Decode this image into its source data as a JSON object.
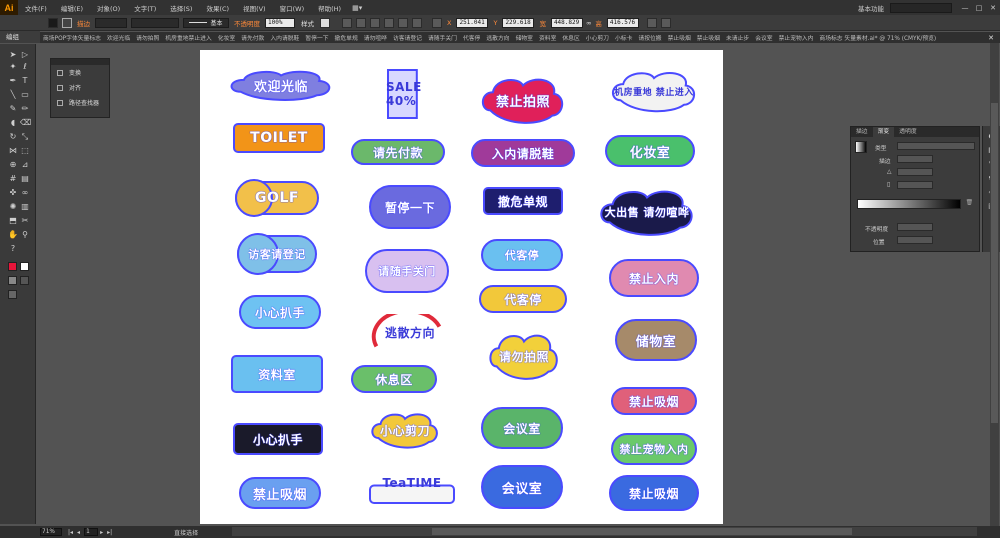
{
  "app": {
    "logo": "Ai",
    "menus": [
      "文件(F)",
      "编辑(E)",
      "对象(O)",
      "文字(T)",
      "选择(S)",
      "效果(C)",
      "视图(V)",
      "窗口(W)",
      "帮助(H)"
    ],
    "workspace": "基本功能",
    "window_controls": [
      "—",
      "□",
      "✕"
    ]
  },
  "control_bar": {
    "edit_label": "编组",
    "fill_label": "描边",
    "stroke_preset": "基本",
    "opacity_label": "不透明度",
    "opacity_value": "100%",
    "style_label": "样式",
    "x_label": "X",
    "x_value": "251.041",
    "y_label": "Y",
    "y_value": "229.618",
    "w_label": "宽",
    "w_value": "448.829",
    "h_label": "高",
    "h_value": "416.576"
  },
  "doc_tabs": [
    "商场POP字体矢量标志",
    "欢迎光临",
    "请勿拍照",
    "机房重地禁止进入",
    "化妆室",
    "请先付款",
    "入内请脱鞋",
    "暂停一下",
    "撤危单规",
    "请勿喧哗",
    "访客请登记",
    "请随手关门",
    "代客停",
    "逃散方向",
    "储物室",
    "资料室",
    "休息区",
    "小心剪刀",
    "小标卡",
    "请按位搬",
    "禁止吸烟",
    "禁止吸烟",
    "未请止步",
    "会议室",
    "禁止宠物入内",
    "商场标志 矢量素材.ai* @ 71% (CMYK/预览)"
  ],
  "small_panel": {
    "items": [
      "变换",
      "对齐",
      "路径查找器"
    ]
  },
  "gradient_panel": {
    "tabs": [
      "描边",
      "渐变",
      "透明度"
    ],
    "type_label": "类型",
    "stroke_label": "描边",
    "angle_label": "△",
    "ratio_label": "▯",
    "opacity_label": "不透明度",
    "location_label": "位置"
  },
  "status_bar": {
    "zoom": "71%",
    "page": "1",
    "tool_status": "直接选择"
  },
  "stickers": [
    {
      "text": "欢迎光临",
      "fill": "#7f7fe0",
      "font": 13
    },
    {
      "text": "SALE 40%",
      "fill": "#d8d8ff",
      "font": 12
    },
    {
      "text": "禁止拍照",
      "fill": "#e0205a",
      "font": 13
    },
    {
      "text": "机房重地 禁止进入",
      "fill": "#f2f2f2",
      "font": 9
    },
    {
      "text": "TOILET",
      "fill": "#f29418",
      "font": 14
    },
    {
      "text": "请先付款",
      "fill": "#6bb86b",
      "font": 12
    },
    {
      "text": "入内请脱鞋",
      "fill": "#a03a9a",
      "font": 12
    },
    {
      "text": "化妆室",
      "fill": "#4ac06c",
      "font": 13
    },
    {
      "text": "GOLF",
      "fill": "#f2c04a",
      "font": 14
    },
    {
      "text": "暂停一下",
      "fill": "#6a6adf",
      "font": 12
    },
    {
      "text": "撤危单规",
      "fill": "#1e1e6e",
      "font": 12
    },
    {
      "text": "大出售 请勿喧哗",
      "fill": "#1a1a4a",
      "font": 11
    },
    {
      "text": "访客请登记",
      "fill": "#7fc0e8",
      "font": 11
    },
    {
      "text": "请随手关门",
      "fill": "#d8c0f0",
      "font": 11
    },
    {
      "text": "代客停",
      "fill": "#6ac0f0",
      "font": 11
    },
    {
      "text": "禁止入内",
      "fill": "#e08ab0",
      "font": 12
    },
    {
      "text": "小心扒手",
      "fill": "#6ec2f2",
      "font": 12
    },
    {
      "text": "逃散方向",
      "fill": "#ffffff",
      "font": 12
    },
    {
      "text": "代客停",
      "fill": "#f2c83a",
      "font": 12
    },
    {
      "text": "储物室",
      "fill": "#a68a6a",
      "font": 13
    },
    {
      "text": "资料室",
      "fill": "#6ac0f0",
      "font": 12
    },
    {
      "text": "休息区",
      "fill": "#6abf6a",
      "font": 12
    },
    {
      "text": "请勿拍照",
      "fill": "#f2d03a",
      "font": 12
    },
    {
      "text": "禁止吸烟",
      "fill": "#e0607a",
      "font": 12
    },
    {
      "text": "小心扒手",
      "fill": "#1a1a2a",
      "font": 12
    },
    {
      "text": "小心剪刀",
      "fill": "#f2c83a",
      "font": 12
    },
    {
      "text": "会议室",
      "fill": "#5ab46a",
      "font": 12
    },
    {
      "text": "禁止宠物入内",
      "fill": "#6ac96a",
      "font": 11
    },
    {
      "text": "禁止吸烟",
      "fill": "#6aa0f0",
      "font": 13
    },
    {
      "text": "TeaTIME",
      "fill": "#ffffff",
      "font": 12
    },
    {
      "text": "会议室",
      "fill": "#3a6ae0",
      "font": 13
    },
    {
      "text": "禁止吸烟",
      "fill": "#3a6ae0",
      "font": 12
    }
  ]
}
